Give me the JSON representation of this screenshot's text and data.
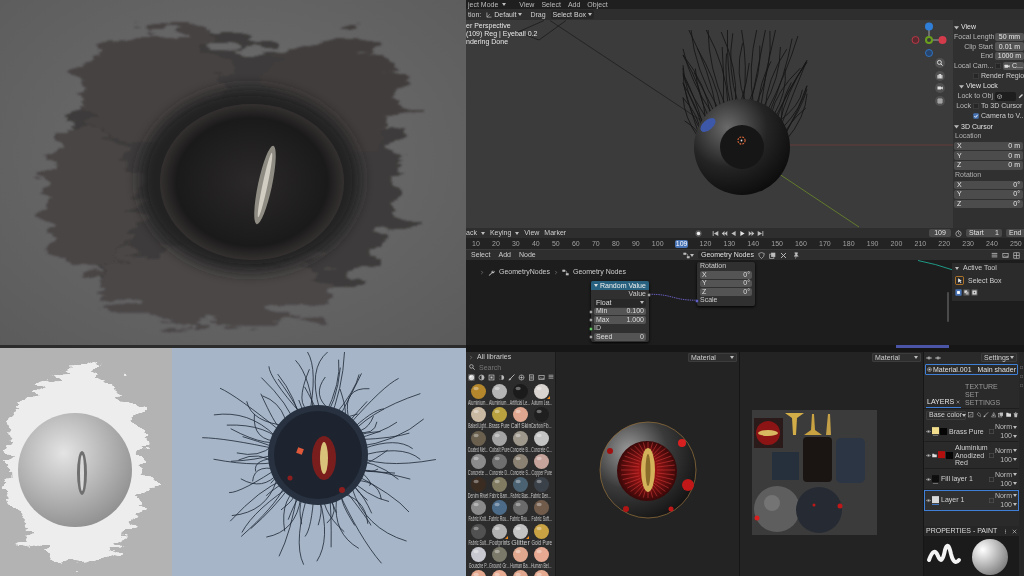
{
  "viewport_3d": {
    "mode": "ject Mode",
    "menus": [
      "View",
      "Select",
      "Add",
      "Object"
    ],
    "tool_settings": [
      {
        "kind": "orientation",
        "label": "tion:",
        "value": "Default"
      },
      {
        "kind": "select",
        "label": "Drag",
        "value": "Select Box"
      }
    ],
    "overlay_lines": [
      "er Perspective",
      "(109) Reg | Eyeball 0.2",
      "ndering Done"
    ],
    "sidebar": [
      {
        "title": "View",
        "expanded": true,
        "rows": [
          {
            "kind": "field",
            "label": "Focal Length",
            "value": "50 mm"
          },
          {
            "kind": "field",
            "label": "Clip Start",
            "value": "0.01 m"
          },
          {
            "kind": "field",
            "label": "End",
            "value": "1000 m"
          },
          {
            "kind": "camera",
            "label": "Local Cam...",
            "checked": false,
            "value": "C..."
          },
          {
            "kind": "check",
            "label": "Render Regio",
            "checked": false
          }
        ]
      },
      {
        "title": "View Lock",
        "expanded": true,
        "rows": [
          {
            "kind": "object",
            "label": "Lock to Obj"
          },
          {
            "kind": "check",
            "caption": "Lock",
            "label": "To 3D Cursor",
            "checked": false
          },
          {
            "kind": "check",
            "label": "Camera to V...",
            "checked": true
          }
        ]
      },
      {
        "title": "3D Cursor",
        "expanded": true,
        "rows": [
          {
            "kind": "heading",
            "label": "Location"
          },
          {
            "kind": "axis",
            "label": "X",
            "value": "0 m"
          },
          {
            "kind": "axis",
            "label": "Y",
            "value": "0 m"
          },
          {
            "kind": "axis",
            "label": "Z",
            "value": "0 m"
          },
          {
            "kind": "heading",
            "label": "Rotation"
          },
          {
            "kind": "axis",
            "label": "X",
            "value": "0°"
          },
          {
            "kind": "axis",
            "label": "Y",
            "value": "0°"
          },
          {
            "kind": "axis",
            "label": "Z",
            "value": "0°"
          }
        ]
      }
    ]
  },
  "timeline": {
    "menus": [
      {
        "label": "ack",
        "dropdown": true
      },
      {
        "label": "Keying",
        "dropdown": true
      },
      {
        "label": "View",
        "dropdown": false
      },
      {
        "label": "Marker",
        "dropdown": false
      }
    ],
    "current_frame": "109",
    "start": {
      "label": "Start",
      "value": "1"
    },
    "end": {
      "label": "End"
    },
    "ruler": [
      {
        "label": "10",
        "selected": false
      },
      {
        "label": "20",
        "selected": false
      },
      {
        "label": "30",
        "selected": false
      },
      {
        "label": "40",
        "selected": false
      },
      {
        "label": "50",
        "selected": false
      },
      {
        "label": "60",
        "selected": false
      },
      {
        "label": "70",
        "selected": false
      },
      {
        "label": "80",
        "selected": false
      },
      {
        "label": "90",
        "selected": false
      },
      {
        "label": "100",
        "selected": false
      },
      {
        "label": "109",
        "selected": true
      },
      {
        "label": "120",
        "selected": false
      },
      {
        "label": "130",
        "selected": false
      },
      {
        "label": "140",
        "selected": false
      },
      {
        "label": "150",
        "selected": false
      },
      {
        "label": "160",
        "selected": false
      },
      {
        "label": "170",
        "selected": false
      },
      {
        "label": "180",
        "selected": false
      },
      {
        "label": "190",
        "selected": false
      },
      {
        "label": "200",
        "selected": false
      },
      {
        "label": "210",
        "selected": false
      },
      {
        "label": "220",
        "selected": false
      },
      {
        "label": "230",
        "selected": false
      },
      {
        "label": "240",
        "selected": false
      },
      {
        "label": "250",
        "selected": false
      }
    ]
  },
  "node_editor": {
    "menus": [
      "Select",
      "Add",
      "Node"
    ],
    "tree": "Geometry Nodes",
    "breadcrumb": [
      "GeometryNodes",
      "Geometry Nodes"
    ],
    "nodes": [
      {
        "kind": "random",
        "title": "Random Value",
        "rows": [
          {
            "kind": "output",
            "label": "Value"
          },
          {
            "kind": "dropdown",
            "label": "Float"
          },
          {
            "kind": "field",
            "label": "Min",
            "value": "0.100"
          },
          {
            "kind": "field",
            "label": "Max",
            "value": "1.000"
          },
          {
            "kind": "input",
            "label": "ID"
          },
          {
            "kind": "field",
            "label": "Seed",
            "value": "0"
          }
        ]
      },
      {
        "kind": "transform",
        "rows": [
          {
            "kind": "heading",
            "label": "Rotation"
          },
          {
            "kind": "axis",
            "label": "X",
            "value": "0°"
          },
          {
            "kind": "axis",
            "label": "Y",
            "value": "0°"
          },
          {
            "kind": "axis",
            "label": "Z",
            "value": "0°"
          },
          {
            "kind": "input",
            "label": "Scale"
          }
        ]
      }
    ],
    "active_tool": {
      "title": "Active Tool",
      "tool": "Select Box"
    }
  },
  "painter": {
    "shelf": {
      "title": "All libraries",
      "search_placeholder": "Search",
      "filters": [
        {
          "kind": "materials",
          "selected": true
        },
        {
          "kind": "smart",
          "selected": false
        },
        {
          "kind": "masks",
          "selected": false
        },
        {
          "kind": "generators",
          "selected": false
        },
        {
          "kind": "brushes",
          "selected": false
        },
        {
          "kind": "particles",
          "selected": false
        },
        {
          "kind": "textures",
          "selected": false
        },
        {
          "kind": "images",
          "selected": false
        }
      ],
      "materials": [
        {
          "label": "Aluminium...",
          "color": "#b5872c",
          "badge": false
        },
        {
          "label": "Aluminium...",
          "color": "#b4b4b4",
          "badge": false
        },
        {
          "label": "Artificial Le...",
          "color": "#1b1b1b",
          "badge": false
        },
        {
          "label": "Autumn Lea...",
          "color": "#d9d4d0",
          "badge": true
        },
        {
          "label": "Baked Light...",
          "color": "#c9b9a2",
          "badge": false
        },
        {
          "label": "Brass Pure",
          "color": "#b9a13f",
          "badge": false
        },
        {
          "label": "Calf Skin",
          "color": "#dfa78f",
          "badge": false
        },
        {
          "label": "Carbon Fib...",
          "color": "#1f1f1f",
          "badge": false
        },
        {
          "label": "Coated Met...",
          "color": "#6b604e",
          "badge": false
        },
        {
          "label": "Cobalt Pure",
          "color": "#a3a3a3",
          "badge": false
        },
        {
          "label": "Concrete B...",
          "color": "#9e978c",
          "badge": false
        },
        {
          "label": "Concrete C...",
          "color": "#c4c4c4",
          "badge": false
        },
        {
          "label": "Concrete ...",
          "color": "#8b8b8b",
          "badge": false
        },
        {
          "label": "Concrete D...",
          "color": "#6f6f6f",
          "badge": false
        },
        {
          "label": "Concrete S...",
          "color": "#8b8172",
          "badge": false
        },
        {
          "label": "Copper Pure",
          "color": "#c6a49b",
          "badge": false
        },
        {
          "label": "Denim Rivet",
          "color": "#3b2c22",
          "badge": false
        },
        {
          "label": "Fabric Bam...",
          "color": "#817b61",
          "badge": false
        },
        {
          "label": "Fabric Bas...",
          "color": "#4b6272",
          "badge": false
        },
        {
          "label": "Fabric Den...",
          "color": "#3b4149",
          "badge": false
        },
        {
          "label": "Fabric Knit...",
          "color": "#8a8a8a",
          "badge": false
        },
        {
          "label": "Fabric Rou...",
          "color": "#4b6b89",
          "badge": false
        },
        {
          "label": "Fabric Rou...",
          "color": "#6b6b6b",
          "badge": false
        },
        {
          "label": "Fabric Soft...",
          "color": "#715b4b",
          "badge": false
        },
        {
          "label": "Fabric Suit...",
          "color": "#515151",
          "badge": false
        },
        {
          "label": "Footprints",
          "color": "#b1b1b1",
          "badge": true
        },
        {
          "label": "Glitter",
          "color": "#c2c2c2",
          "badge": true
        },
        {
          "label": "Gold Pure",
          "color": "#c9a243",
          "badge": false
        },
        {
          "label": "Gouache P...",
          "color": "#c8c8d0",
          "badge": false
        },
        {
          "label": "Ground Gr...",
          "color": "#7b7969",
          "badge": false
        },
        {
          "label": "Human Ba...",
          "color": "#e0a98f",
          "badge": false
        },
        {
          "label": "Human Bel...",
          "color": "#e7a991",
          "badge": false
        },
        {
          "color": "#e2a78c",
          "badge": false
        },
        {
          "color": "#e6ab91",
          "badge": false
        },
        {
          "color": "#e0a68d",
          "badge": false
        },
        {
          "color": "#e4a98f",
          "badge": false
        }
      ]
    },
    "view_3d": {
      "mode": "Material"
    },
    "view_2d": {
      "mode": "Material"
    },
    "layers_panel": {
      "settings": "Settings",
      "texture_set": {
        "name": "Material.001",
        "shader": "Main shader",
        "selected": true
      },
      "tabs": [
        {
          "label": "LAYERS",
          "selected": true,
          "closable": true
        },
        {
          "label": "TEXTURE SET SETTINGS",
          "selected": false,
          "closable": false
        }
      ],
      "channel": "Base color",
      "layers": [
        {
          "kind": "fill",
          "name": "Brass Pure",
          "color": "#f1dd8b",
          "mask": true,
          "blend": "Norm",
          "opacity": "100",
          "selected": false
        },
        {
          "kind": "folder",
          "name": "Aluminium Anodized Red",
          "color": "#b20f0f",
          "mask": true,
          "blend": "Norm",
          "opacity": "100",
          "selected": false
        },
        {
          "kind": "fill",
          "name": "Fill layer 1",
          "color": "#0e0e0e",
          "mask": false,
          "blend": "Norm",
          "opacity": "100",
          "selected": false
        },
        {
          "kind": "paint",
          "name": "Layer 1",
          "color": "#d9d9d9",
          "mask": false,
          "blend": "Norm",
          "opacity": "100",
          "selected": true
        }
      ],
      "properties_title": "PROPERTIES - PAINT"
    }
  }
}
